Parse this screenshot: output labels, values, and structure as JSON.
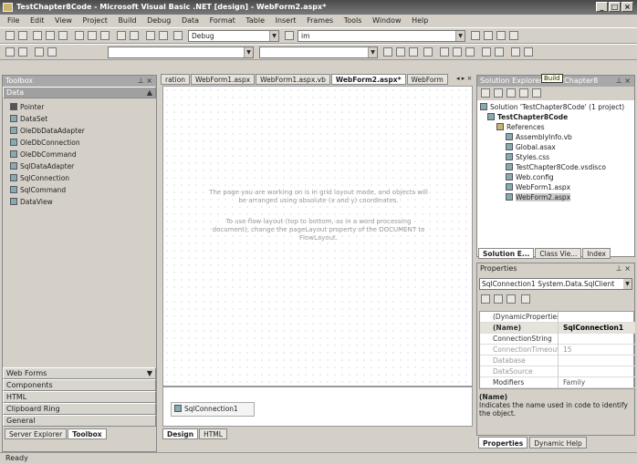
{
  "window": {
    "title": "TestChapter8Code - Microsoft Visual Basic .NET [design] - WebForm2.aspx*",
    "minimize": "_",
    "maximize": "□",
    "close": "×"
  },
  "menu": [
    "File",
    "Edit",
    "View",
    "Project",
    "Build",
    "Debug",
    "Data",
    "Format",
    "Table",
    "Insert",
    "Frames",
    "Tools",
    "Window",
    "Help"
  ],
  "toolbar1": {
    "config_combo": "Debug",
    "find_combo": "im"
  },
  "toolbox": {
    "title": "Toolbox",
    "section": "Data",
    "items": [
      "Pointer",
      "DataSet",
      "OleDbDataAdapter",
      "OleDbConnection",
      "OleDbCommand",
      "SqlDataAdapter",
      "SqlConnection",
      "SqlCommand",
      "DataView"
    ],
    "categories": [
      "Web Forms",
      "Components",
      "HTML",
      "Clipboard Ring",
      "General"
    ],
    "bottom_tabs": [
      "Server Explorer",
      "Toolbox"
    ]
  },
  "doc_tabs": [
    "ration",
    "WebForm1.aspx",
    "WebForm1.aspx.vb",
    "WebForm2.aspx*",
    "WebForm"
  ],
  "designer": {
    "message1": "The page you are working on is in grid layout mode, and objects will be arranged using absolute (x and y) coordinates.",
    "message2": "To use flow layout (top to bottom, as in a word processing document), change the pageLayout property of the DOCUMENT to FlowLayout.",
    "component": "SqlConnection1",
    "view_tabs": [
      "Design",
      "HTML"
    ]
  },
  "solution_explorer": {
    "title": "Solution Explorer - TestChapter8",
    "tooltip": "Build",
    "solution": "Solution 'TestChapter8Code' (1 project)",
    "project": "TestChapter8Code",
    "items": [
      "References",
      "AssemblyInfo.vb",
      "Global.asax",
      "Styles.css",
      "TestChapter8Code.vsdisco",
      "Web.config",
      "WebForm1.aspx",
      "WebForm2.aspx"
    ],
    "bottom_tabs": [
      "Solution E...",
      "Class Vie...",
      "Index"
    ]
  },
  "properties": {
    "title": "Properties",
    "object": "SqlConnection1  System.Data.SqlClient",
    "rows": [
      {
        "name": "(DynamicProperties)",
        "value": ""
      },
      {
        "name": "(Name)",
        "value": "SqlConnection1"
      },
      {
        "name": "ConnectionString",
        "value": ""
      },
      {
        "name": "ConnectionTimeout",
        "value": "15"
      },
      {
        "name": "Database",
        "value": ""
      },
      {
        "name": "DataSource",
        "value": ""
      },
      {
        "name": "Modifiers",
        "value": "Family"
      }
    ],
    "desc_title": "(Name)",
    "desc_text": "Indicates the name used in code to identify the object.",
    "bottom_tabs": [
      "Properties",
      "Dynamic Help"
    ]
  },
  "status": "Ready"
}
